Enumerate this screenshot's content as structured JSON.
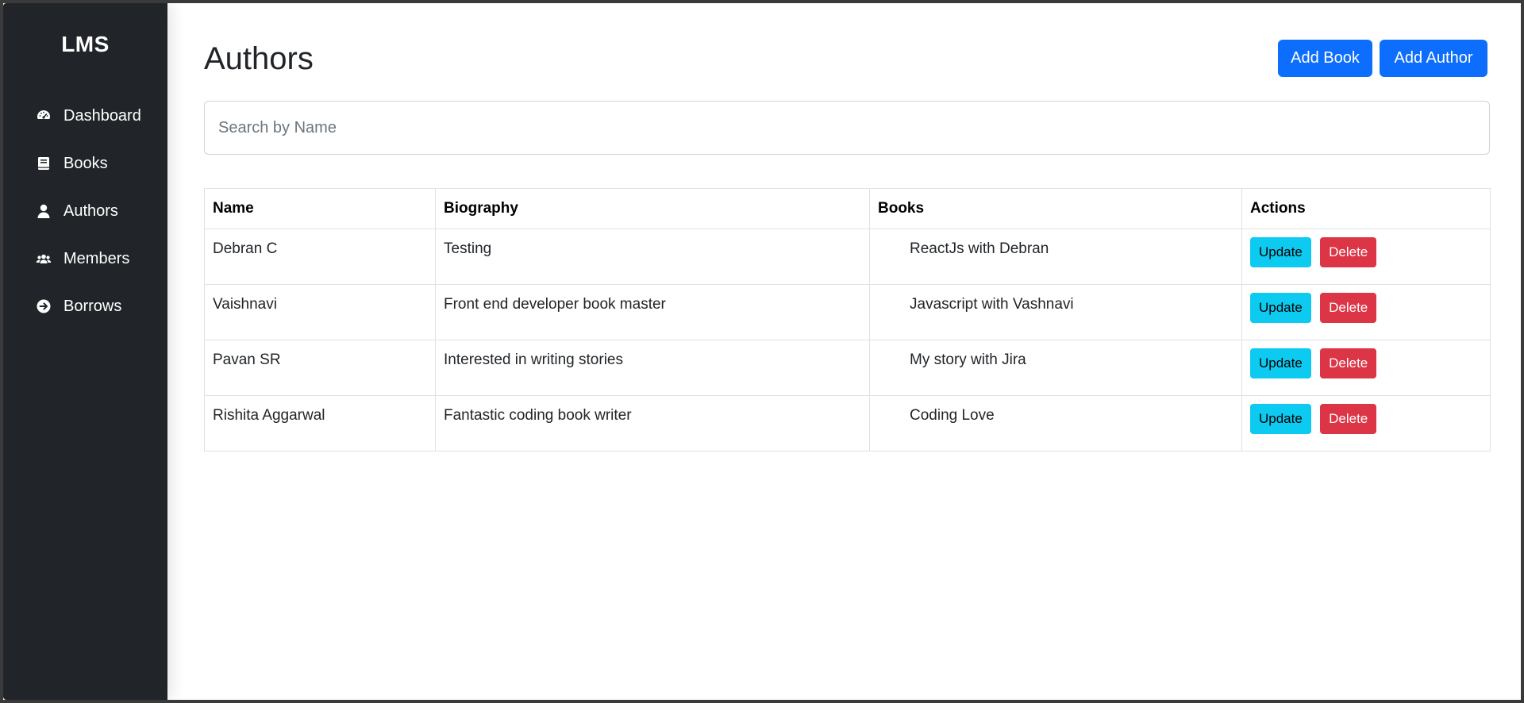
{
  "sidebar": {
    "brand": "LMS",
    "items": [
      {
        "label": "Dashboard",
        "icon": "dashboard-gauge-icon"
      },
      {
        "label": "Books",
        "icon": "book-icon"
      },
      {
        "label": "Authors",
        "icon": "user-icon"
      },
      {
        "label": "Members",
        "icon": "users-icon"
      },
      {
        "label": "Borrows",
        "icon": "arrow-circle-right-icon"
      }
    ]
  },
  "header": {
    "title": "Authors",
    "add_book_label": "Add Book",
    "add_author_label": "Add Author"
  },
  "search": {
    "placeholder": "Search by Name",
    "value": ""
  },
  "table": {
    "columns": [
      "Name",
      "Biography",
      "Books",
      "Actions"
    ],
    "rows": [
      {
        "name": "Debran C",
        "biography": "Testing",
        "books": [
          "ReactJs with Debran"
        ]
      },
      {
        "name": "Vaishnavi",
        "biography": "Front end developer book master",
        "books": [
          "Javascript with Vashnavi"
        ]
      },
      {
        "name": "Pavan SR",
        "biography": "Interested in writing stories",
        "books": [
          "My story with Jira"
        ]
      },
      {
        "name": "Rishita Aggarwal",
        "biography": "Fantastic coding book writer",
        "books": [
          "Coding Love"
        ]
      }
    ],
    "update_label": "Update",
    "delete_label": "Delete"
  },
  "colors": {
    "sidebar_bg": "#212529",
    "primary": "#0d6efd",
    "info": "#0dcaf0",
    "danger": "#dc3545"
  }
}
